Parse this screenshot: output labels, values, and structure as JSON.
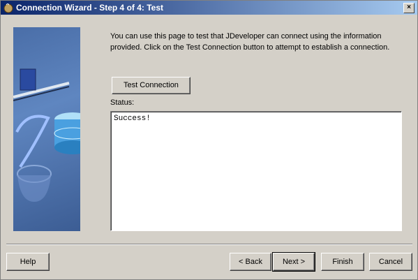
{
  "window": {
    "title": "Connection Wizard - Step 4 of 4: Test",
    "close_glyph": "×"
  },
  "intro_text": "You can use this page to test that JDeveloper can connect using the information provided.  Click on the Test Connection button to attempt to establish a connection.",
  "test_button_label": "Test Connection",
  "status": {
    "label": "Status:",
    "value": "Success!"
  },
  "buttons": {
    "help": "Help",
    "back": "< Back",
    "next": "Next >",
    "finish": "Finish",
    "cancel": "Cancel"
  },
  "colors": {
    "titlebar_start": "#0a246a",
    "titlebar_end": "#a6caf0",
    "dialog_bg": "#d4d0c8",
    "side_panel": "#4a6ea8"
  }
}
